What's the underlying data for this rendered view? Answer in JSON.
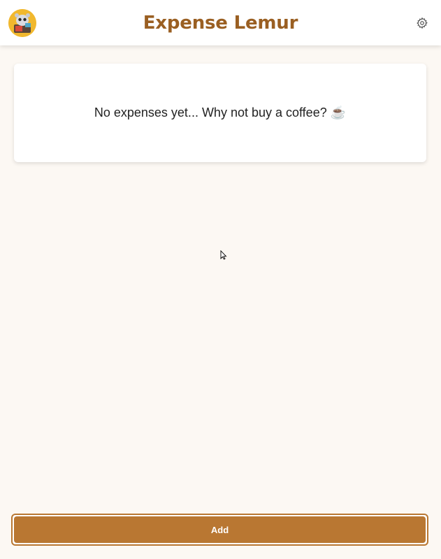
{
  "header": {
    "title": "Expense Lemur",
    "logo_icon": "lemur-logo-icon",
    "settings_icon": "gear-icon"
  },
  "main": {
    "empty_message": "No expenses yet... Why not buy a coffee? ☕"
  },
  "footer": {
    "add_label": "Add"
  },
  "colors": {
    "brand": "#9a5f22",
    "accent": "#b97732",
    "background": "#fcf8f3",
    "logo_bg": "#f1b82e"
  }
}
